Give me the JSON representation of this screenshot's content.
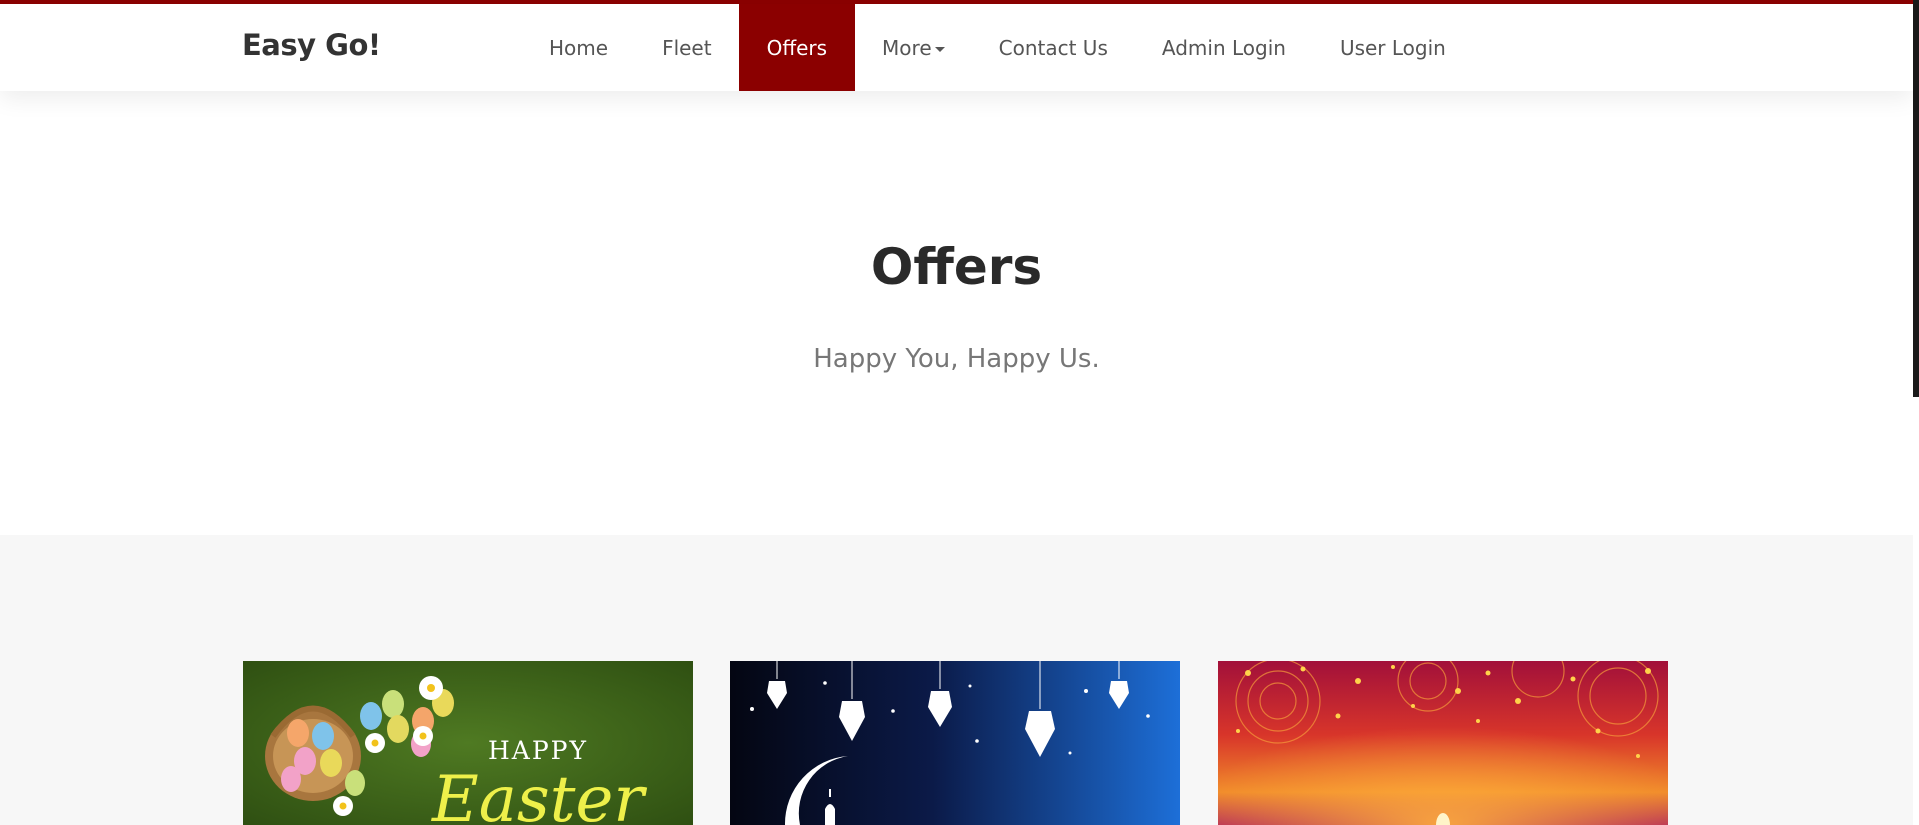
{
  "brand": {
    "name": "Easy Go!"
  },
  "nav": {
    "items": [
      {
        "label": "Home",
        "active": false
      },
      {
        "label": "Fleet",
        "active": false
      },
      {
        "label": "Offers",
        "active": true
      },
      {
        "label": "More",
        "active": false,
        "dropdown": true
      },
      {
        "label": "Contact Us",
        "active": false
      },
      {
        "label": "Admin Login",
        "active": false
      },
      {
        "label": "User Login",
        "active": false
      }
    ]
  },
  "hero": {
    "title": "Offers",
    "subtitle": "Happy You, Happy Us."
  },
  "offers": {
    "cards": [
      {
        "image": "easter-banner",
        "text_top": "HAPPY",
        "text_main": "Easter"
      },
      {
        "image": "ramadan-banner"
      },
      {
        "image": "diwali-banner"
      }
    ]
  },
  "colors": {
    "accent": "#8b0000",
    "nav_text": "#555555",
    "section_bg": "#f7f7f7"
  }
}
